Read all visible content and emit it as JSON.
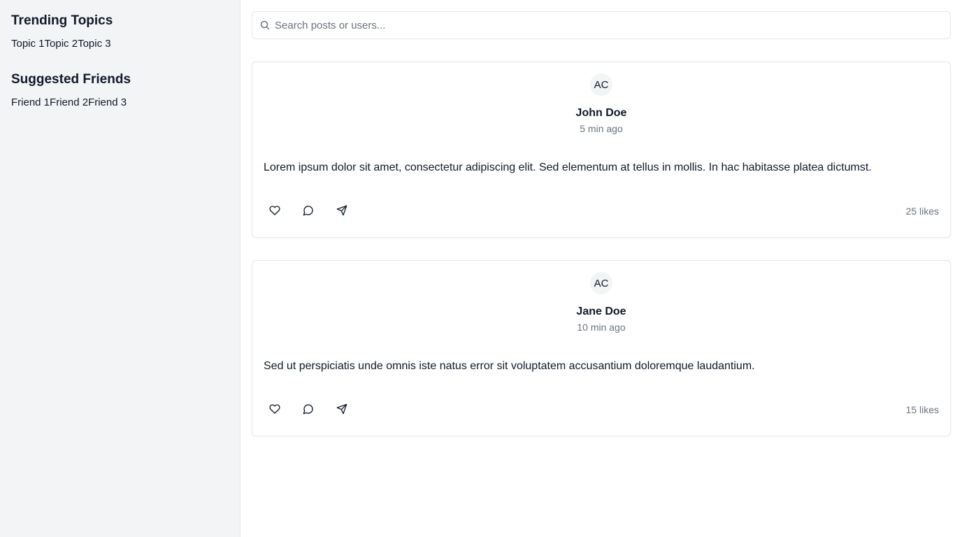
{
  "sidebar": {
    "trending_title": "Trending Topics",
    "topics": [
      "Topic 1",
      "Topic 2",
      "Topic 3"
    ],
    "friends_title": "Suggested Friends",
    "friends": [
      "Friend 1",
      "Friend 2",
      "Friend 3"
    ]
  },
  "search": {
    "placeholder": "Search posts or users...",
    "icon": "search-icon"
  },
  "posts": [
    {
      "avatar": "AC",
      "author": "John Doe",
      "time": "5 min ago",
      "body": "Lorem ipsum dolor sit amet, consectetur adipiscing elit. Sed elementum at tellus in mollis. In hac habitasse platea dictumst.",
      "likes": "25 likes"
    },
    {
      "avatar": "AC",
      "author": "Jane Doe",
      "time": "10 min ago",
      "body": "Sed ut perspiciatis unde omnis iste natus error sit voluptatem accusantium doloremque laudantium.",
      "likes": "15 likes"
    }
  ],
  "action_icons": [
    "heart-icon",
    "comment-icon",
    "send-icon"
  ],
  "colors": {
    "sidebar_bg": "#f3f4f6",
    "border": "#e5e7eb",
    "muted_text": "#6b7280"
  }
}
